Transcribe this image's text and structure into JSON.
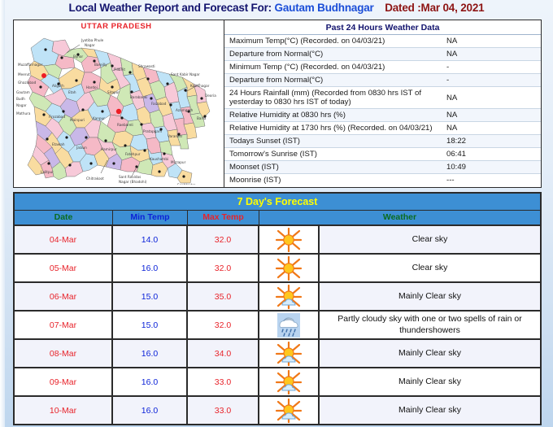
{
  "title": {
    "main": "Local Weather Report and Forecast For:",
    "place": "Gautam Budhnagar",
    "date": "Dated :Mar 04, 2021"
  },
  "map": {
    "title": "UTTAR PRADESH",
    "icon": "india-state-district-map"
  },
  "past24": {
    "heading": "Past 24 Hours Weather Data",
    "rows": [
      {
        "label": "Maximum Temp(°C) (Recorded. on 04/03/21)",
        "value": "NA"
      },
      {
        "label": "Departure from Normal(°C)",
        "value": "NA"
      },
      {
        "label": "Minimum Temp (°C) (Recorded. on 04/03/21)",
        "value": "-"
      },
      {
        "label": "Departure from Normal(°C)",
        "value": "-"
      },
      {
        "label": "24 Hours Rainfall (mm) (Recorded from 0830 hrs IST of yesterday to 0830 hrs IST of today)",
        "value": "NA"
      },
      {
        "label": "Relative Humidity at 0830 hrs (%)",
        "value": "NA"
      },
      {
        "label": "Relative Humidity at 1730 hrs (%) (Recorded. on 04/03/21)",
        "value": "NA"
      },
      {
        "label": "Todays Sunset (IST)",
        "value": "18:22"
      },
      {
        "label": "Tomorrow's Sunrise (IST)",
        "value": "06:41"
      },
      {
        "label": "Moonset (IST)",
        "value": "10:49"
      },
      {
        "label": "Moonrise (IST)",
        "value": "---"
      }
    ]
  },
  "forecast": {
    "title": "7 Day's Forecast",
    "columns": {
      "date": "Date",
      "min": "Min Temp",
      "max": "Max Temp",
      "weather": "Weather"
    },
    "rows": [
      {
        "date": "04-Mar",
        "min": "14.0",
        "max": "32.0",
        "icon": "sun-icon",
        "weather": "Clear sky"
      },
      {
        "date": "05-Mar",
        "min": "16.0",
        "max": "32.0",
        "icon": "sun-icon",
        "weather": "Clear sky"
      },
      {
        "date": "06-Mar",
        "min": "15.0",
        "max": "35.0",
        "icon": "sun-cloud-icon",
        "weather": "Mainly Clear sky"
      },
      {
        "date": "07-Mar",
        "min": "15.0",
        "max": "32.0",
        "icon": "rain-cloud-icon",
        "weather": "Partly cloudy sky with one or two spells of rain or thundershowers"
      },
      {
        "date": "08-Mar",
        "min": "16.0",
        "max": "34.0",
        "icon": "sun-cloud-icon",
        "weather": "Mainly Clear sky"
      },
      {
        "date": "09-Mar",
        "min": "16.0",
        "max": "33.0",
        "icon": "sun-cloud-icon",
        "weather": "Mainly Clear sky"
      },
      {
        "date": "10-Mar",
        "min": "16.0",
        "max": "33.0",
        "icon": "sun-cloud-icon",
        "weather": "Mainly Clear sky"
      }
    ]
  },
  "colors": {
    "header_blue": "#3d8fd4",
    "title_yellow": "#ffff00",
    "red": "#e8232a",
    "blue": "#0c23d8",
    "green": "#0a6b20",
    "navy": "#13146e"
  }
}
